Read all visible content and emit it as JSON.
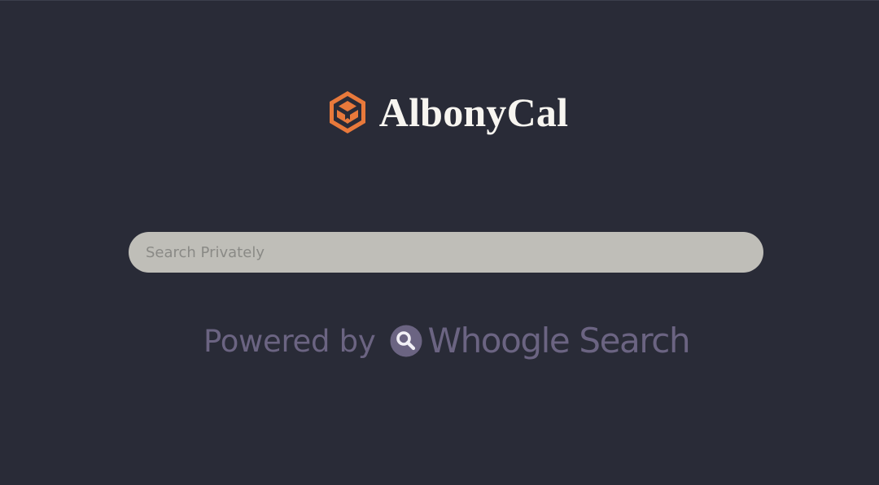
{
  "brand": {
    "name": "AlbonyCal",
    "logo_icon": "hexagon-cube-logo-icon",
    "logo_color": "#e8793b"
  },
  "search": {
    "placeholder": "Search Privately",
    "value": ""
  },
  "footer": {
    "powered_by": "Powered by",
    "engine_name": "Whoogle Search",
    "engine_icon": "magnifier-icon",
    "engine_color": "#6b6482"
  },
  "colors": {
    "background": "#292b37",
    "search_bar": "#bfbeb8",
    "title_text": "#f7f5f0"
  }
}
